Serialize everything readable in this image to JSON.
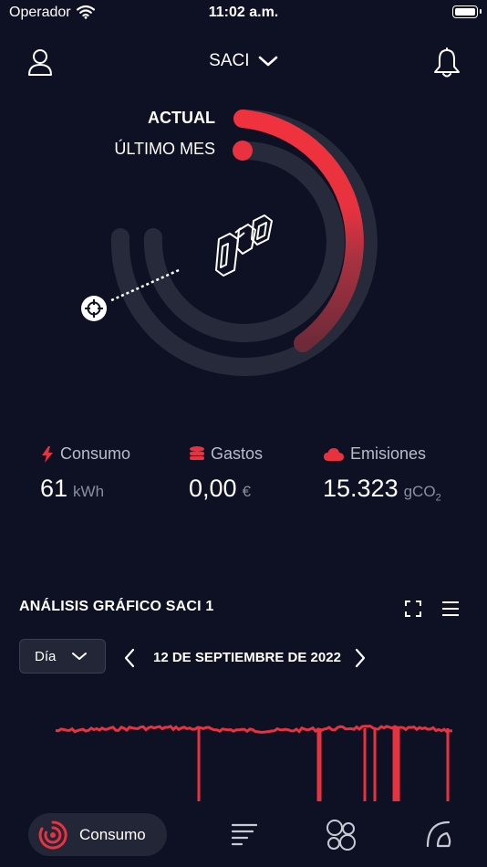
{
  "status_bar": {
    "carrier": "Operador",
    "time": "11:02 a.m."
  },
  "header": {
    "device": "SACI"
  },
  "ring": {
    "actual_label": "ACTUAL",
    "last_month_label": "ÚLTIMO MES"
  },
  "stats": {
    "consumo": {
      "label": "Consumo",
      "value": "61",
      "unit": "kWh"
    },
    "gastos": {
      "label": "Gastos",
      "value": "0,00",
      "unit": "€"
    },
    "emisiones": {
      "label": "Emisiones",
      "value": "15.323",
      "unit": "gCO",
      "unit_sub": "2"
    }
  },
  "analysis": {
    "title": "ANÁLISIS GRÁFICO SACI 1",
    "period": "Día",
    "date": "12 DE SEPTIEMBRE DE 2022"
  },
  "tab_bar": {
    "active_label": "Consumo"
  },
  "colors": {
    "background": "#0d1123",
    "accent": "#e8323f",
    "ring_track": "#262a3b"
  }
}
